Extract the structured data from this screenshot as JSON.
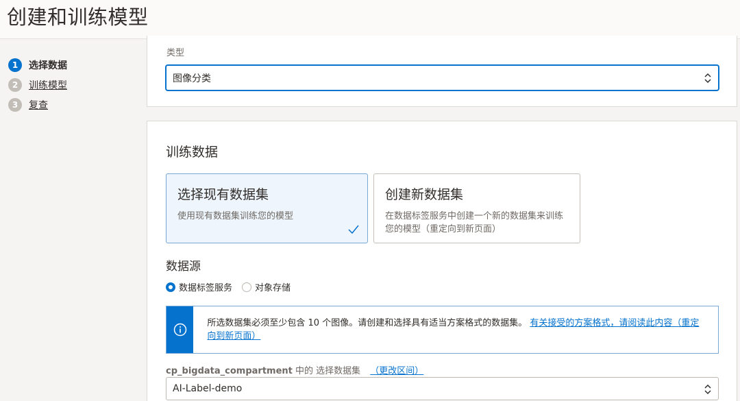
{
  "page": {
    "title": "创建和训练模型"
  },
  "steps": [
    {
      "num": "1",
      "label": "选择数据",
      "state": "active"
    },
    {
      "num": "2",
      "label": "训练模型",
      "state": "inactive"
    },
    {
      "num": "3",
      "label": "复查",
      "state": "inactive"
    }
  ],
  "type_field": {
    "label": "类型",
    "value": "图像分类"
  },
  "training": {
    "title": "训练数据",
    "cards": [
      {
        "title": "选择现有数据集",
        "desc": "使用现有数据集训练您的模型",
        "selected": true
      },
      {
        "title": "创建新数据集",
        "desc": "在数据标签服务中创建一个新的数据集来训练您的模型（重定向到新页面）",
        "selected": false
      }
    ]
  },
  "datasource": {
    "title": "数据源",
    "options": [
      {
        "label": "数据标签服务",
        "checked": true
      },
      {
        "label": "对象存储",
        "checked": false
      }
    ]
  },
  "info": {
    "text": "所选数据集必须至少包含 10 个图像。请创建和选择具有适当方案格式的数据集。",
    "link": "有关接受的方案格式，请阅读此内容（重定向到新页面）"
  },
  "compartment": {
    "name": "cp_bigdata_compartment",
    "middle": " 中的 选择数据集",
    "change_link": "（更改区间）"
  },
  "dataset_select": {
    "value": "AI-Label-demo"
  },
  "colors": {
    "accent": "#0572ce",
    "text": "#312d2a",
    "muted": "#6f6a65"
  }
}
